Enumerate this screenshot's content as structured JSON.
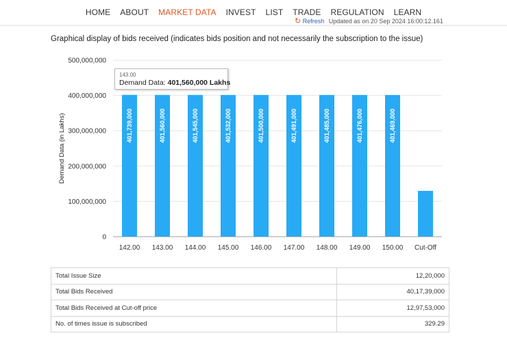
{
  "nav": {
    "items": [
      "HOME",
      "ABOUT",
      "MARKET DATA",
      "INVEST",
      "LIST",
      "TRADE",
      "REGULATION",
      "LEARN"
    ],
    "active_index": 2
  },
  "refresh": {
    "label": "Refresh",
    "updated_text": "Updated as on 20 Sep 2024 16:00:12.161"
  },
  "chart": {
    "caption": "Graphical display of bids received (indicates bids position and not necessarily the subscription to the issue)"
  },
  "chart_data": {
    "type": "bar",
    "title": "",
    "xlabel": "",
    "ylabel": "Demand Data (in Lakhs)",
    "categories": [
      "142.00",
      "143.00",
      "144.00",
      "145.00",
      "146.00",
      "147.00",
      "148.00",
      "149.00",
      "150.00",
      "Cut-Off"
    ],
    "values": [
      401739000,
      401560000,
      401545000,
      401532000,
      401500000,
      401491000,
      401485000,
      401476000,
      401469000,
      129753000
    ],
    "data_labels": [
      "401,739,000",
      "401,560,000",
      "401,545,000",
      "401,532,000",
      "401,500,000",
      "401,491,000",
      "401,485,000",
      "401,476,000",
      "401,469,000",
      ""
    ],
    "ylim": [
      0,
      500000000
    ],
    "yticks": [
      "0",
      "100,000,000",
      "200,000,000",
      "300,000,000",
      "400,000,000",
      "500,000,000"
    ],
    "grid": true,
    "bar_color": "#29aaf4",
    "tooltip": {
      "category": "143.00",
      "label": "Demand Data: ",
      "value": "401,560,000 Lakhs"
    }
  },
  "summary": {
    "rows": [
      {
        "label": "Total Issue Size",
        "value": "12,20,000"
      },
      {
        "label": "Total Bids Received",
        "value": "40,17,39,000"
      },
      {
        "label": "Total Bids Received at Cut-off price",
        "value": "12,97,53,000"
      },
      {
        "label": "No. of times issue is subscribed",
        "value": "329.29"
      }
    ]
  }
}
